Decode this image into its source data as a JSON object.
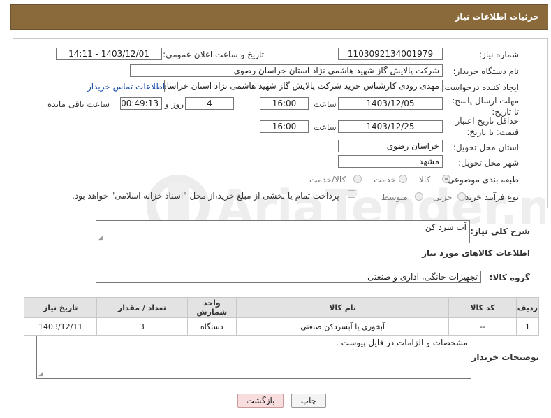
{
  "header": {
    "title": "جزئیات اطلاعات نیاز"
  },
  "form": {
    "need_number_label": "شماره نیاز:",
    "need_number": "1103092134001979",
    "announce_label": "تاریخ و ساعت اعلان عمومی:",
    "announce_value": "1403/12/01 - 14:11",
    "buyer_label": "نام دستگاه خریدار:",
    "buyer_value": "شرکت پالایش گاز شهید هاشمی نژاد   استان خراسان رضوی",
    "creator_label": "ایجاد کننده درخواست:",
    "creator_value": "مهدی رودی کارشناس خرید شرکت پالایش گاز شهید هاشمی نژاد   استان خراسان رضوی",
    "contact_link": "اطلاعات تماس خریدار",
    "deadline_label": "مهلت ارسال پاسخ: تا تاریخ:",
    "deadline_date": "1403/12/05",
    "time_label": "ساعت",
    "deadline_time": "16:00",
    "days_value": "4",
    "days_label": "روز و",
    "remaining_time": "00:49:13",
    "remaining_label": "ساعت باقی مانده",
    "validity_label": "حداقل تاریخ اعتبار قیمت: تا تاریخ:",
    "validity_date": "1403/12/25",
    "validity_time": "16:00",
    "province_label": "استان محل تحویل:",
    "province_value": "خراسان رضوی",
    "city_label": "شهر محل تحویل:",
    "city_value": "مشهد",
    "category_label": "طبقه بندی موضوعی:",
    "category_options": [
      "کالا",
      "خدمت",
      "کالا/خدمت"
    ],
    "category_selected": "کالا",
    "process_label": "نوع فرآیند خرید :",
    "process_options": [
      "جزیی",
      "متوسط"
    ],
    "payment_note": "پرداخت تمام یا بخشی از مبلغ خرید،از محل \"اسناد خزانه اسلامی\" خواهد بود."
  },
  "description": {
    "label": "شرح کلی نیاز:",
    "value": "آب سرد کن"
  },
  "goods": {
    "section_title": "اطلاعات کالاهای مورد نیاز",
    "group_label": "گروه کالا:",
    "group_value": "تجهیزات خانگی، اداری و صنعتی",
    "columns": [
      "ردیف",
      "کد کالا",
      "نام کالا",
      "واحد شمارش",
      "تعداد / مقدار",
      "تاریخ نیاز"
    ],
    "rows": [
      [
        "1",
        "--",
        "آبخوری یا آبسردکن صنعتی",
        "دستگاه",
        "3",
        "1403/12/11"
      ]
    ]
  },
  "buyer_notes": {
    "label": "توضیحات خریدار:",
    "value": "مشخصات و الزامات در فایل پیوست ."
  },
  "buttons": {
    "print": "چاپ",
    "back": "بازگشت"
  },
  "watermark": {
    "text": "AriaTender.net"
  }
}
